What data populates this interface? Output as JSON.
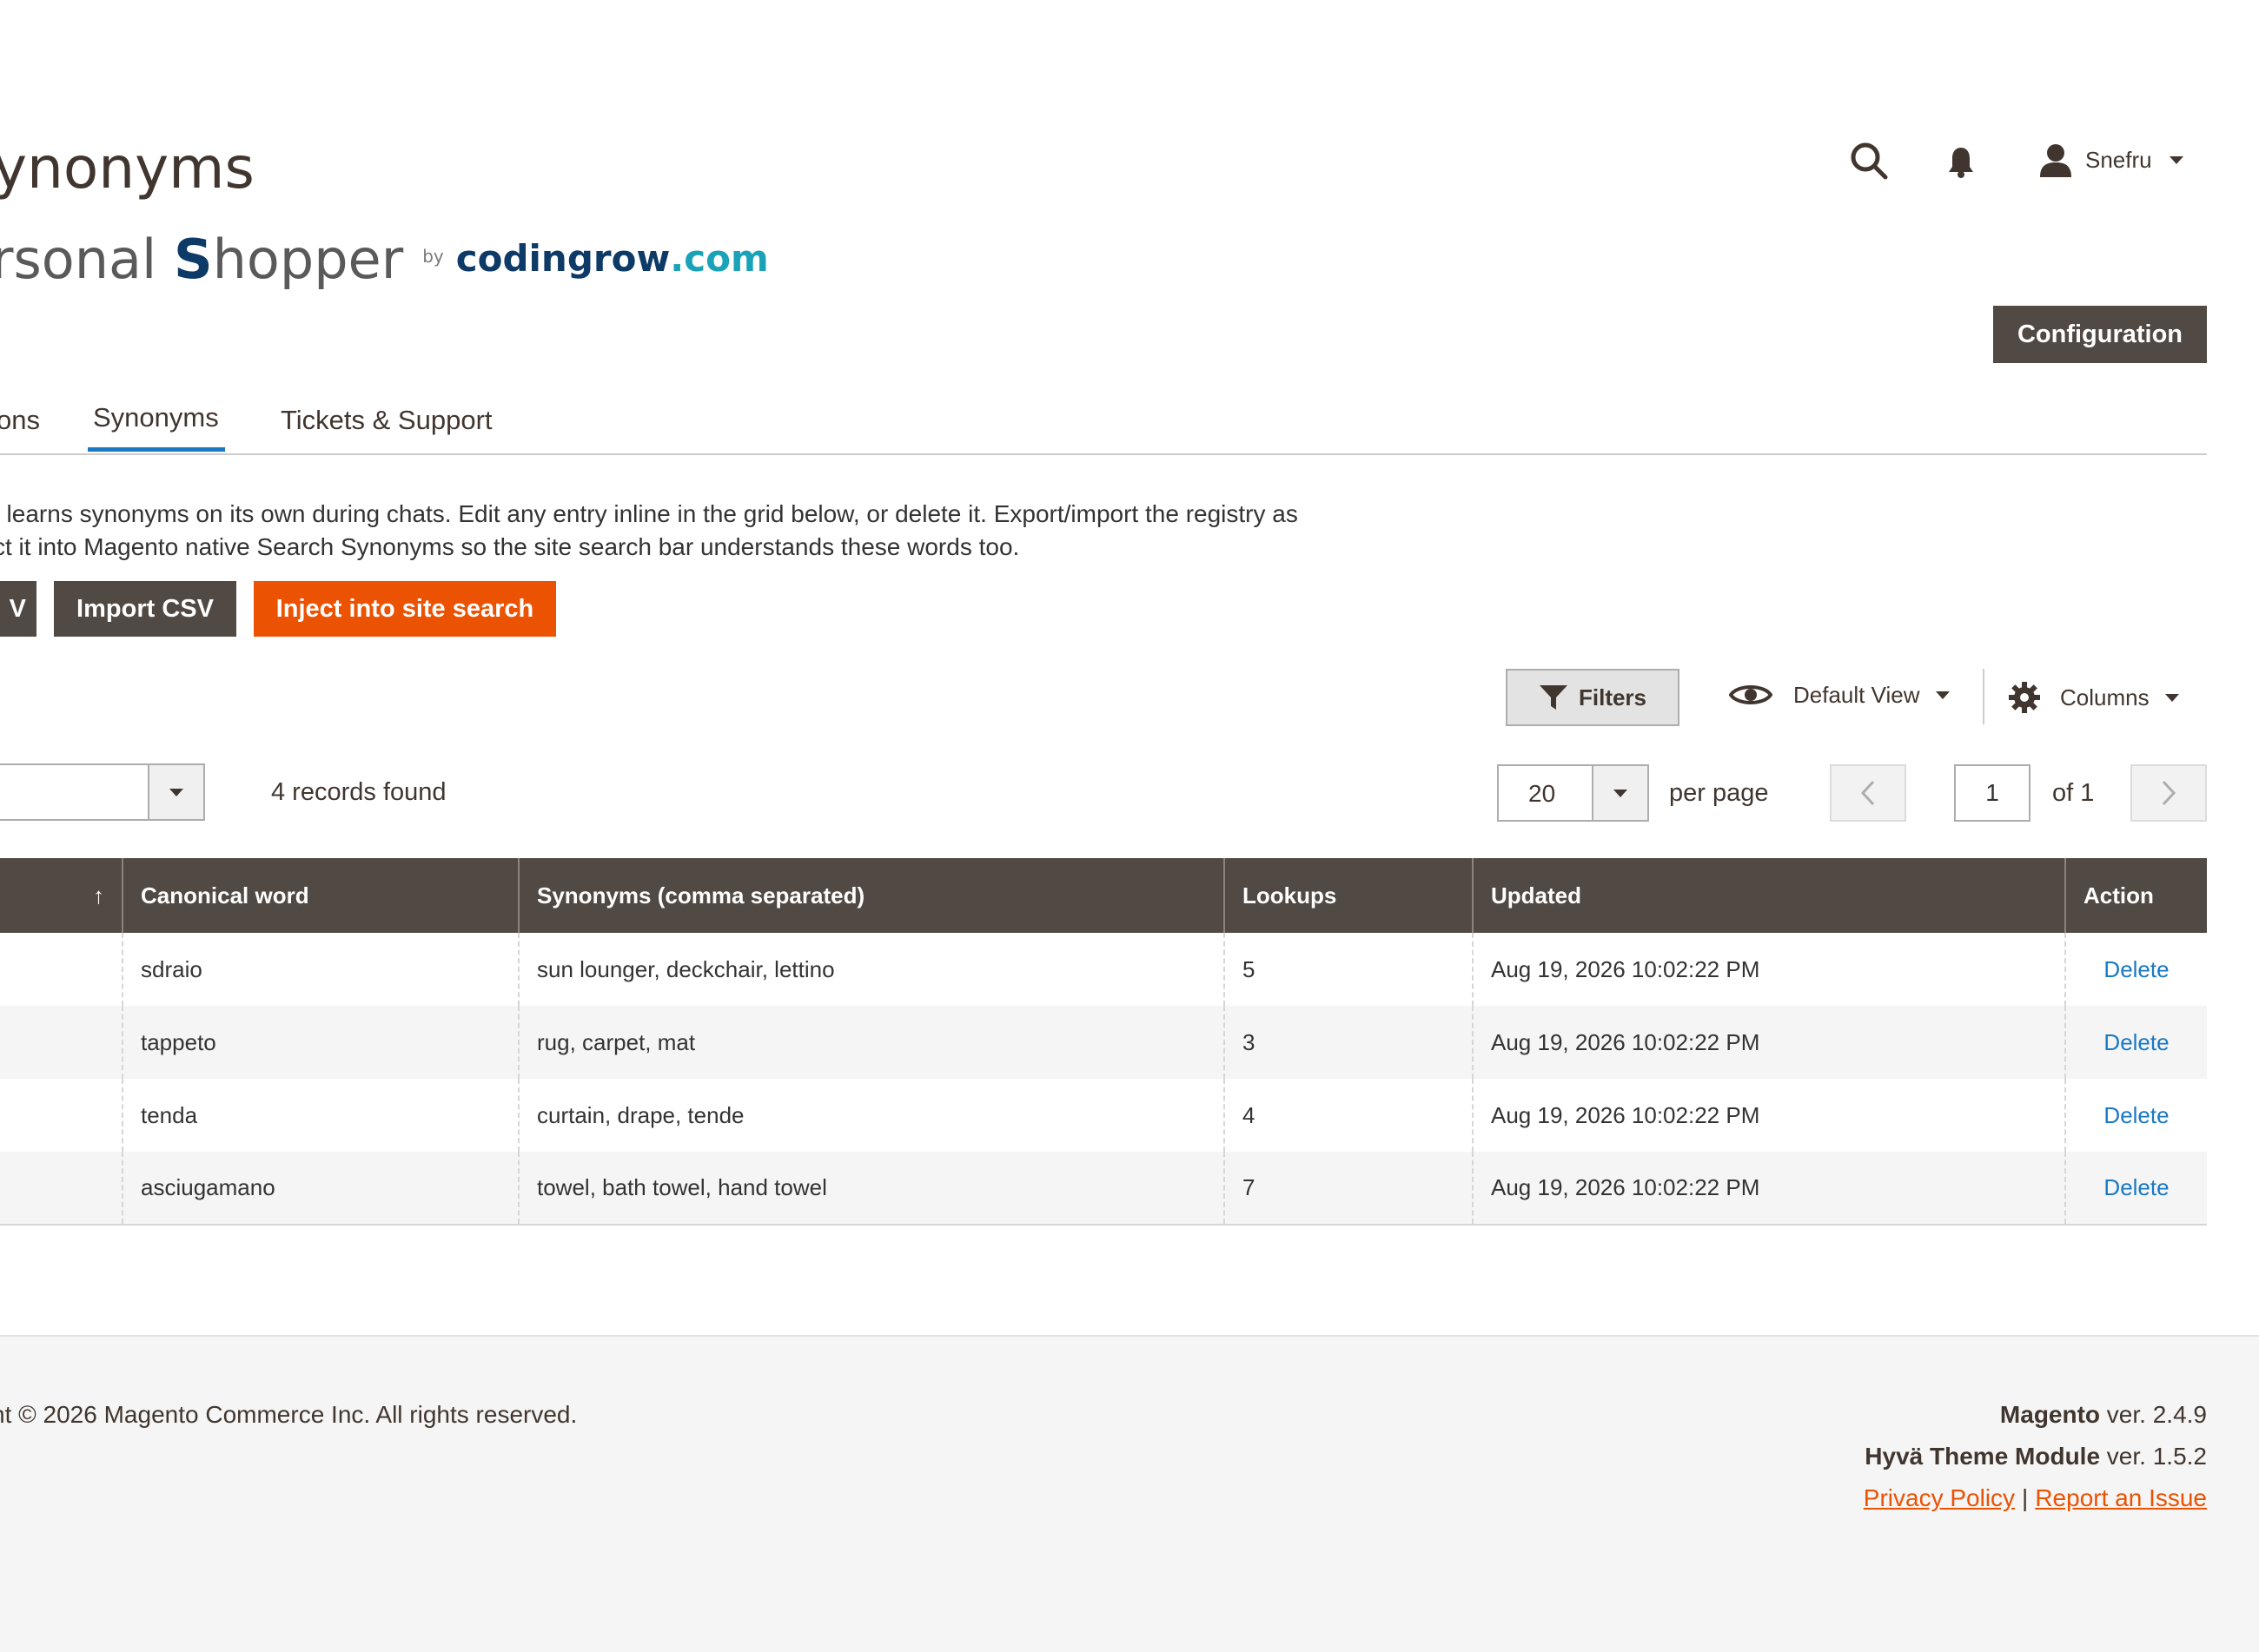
{
  "header": {
    "title": "ynonyms",
    "user_name": "Snefru",
    "icons": [
      "search-icon",
      "bell-icon",
      "user-icon",
      "chevron-down-icon"
    ]
  },
  "logo": {
    "text_start": "rsonal ",
    "text_s": "S",
    "text_end": "hopper",
    "by": "by",
    "brand_part1": "codingrow",
    "brand_part2": ".com"
  },
  "actions": {
    "configuration_label": "Configuration"
  },
  "tabs": [
    {
      "label": "ons",
      "active": false
    },
    {
      "label": "Synonyms",
      "active": true
    },
    {
      "label": "Tickets & Support",
      "active": false
    }
  ],
  "description": {
    "line1": "t learns synonyms on its own during chats. Edit any entry inline in the grid below, or delete it. Export/import the registry as",
    "line2": "ct it into Magento native Search Synonyms so the site search bar understands these words too."
  },
  "registry_buttons": {
    "export_label": "V",
    "import_label": "Import CSV",
    "inject_label": "Inject into site search"
  },
  "toolbar": {
    "filters_label": "Filters",
    "view_label": "Default View",
    "columns_label": "Columns",
    "records_found": "4 records found",
    "per_page_value": "20",
    "per_page_label": "per page",
    "current_page": "1",
    "of_pages": "of 1"
  },
  "grid": {
    "columns": [
      "Canonical word",
      "Synonyms (comma separated)",
      "Lookups",
      "Updated",
      "Action"
    ],
    "sort_indicator": "↑",
    "rows": [
      {
        "canonical": "sdraio",
        "synonyms": "sun lounger, deckchair, lettino",
        "lookups": "5",
        "updated": "Aug 19, 2026 10:02:22 PM",
        "action": "Delete"
      },
      {
        "canonical": "tappeto",
        "synonyms": "rug, carpet, mat",
        "lookups": "3",
        "updated": "Aug 19, 2026 10:02:22 PM",
        "action": "Delete"
      },
      {
        "canonical": "tenda",
        "synonyms": "curtain, drape, tende",
        "lookups": "4",
        "updated": "Aug 19, 2026 10:02:22 PM",
        "action": "Delete"
      },
      {
        "canonical": "asciugamano",
        "synonyms": "towel, bath towel, hand towel",
        "lookups": "7",
        "updated": "Aug 19, 2026 10:02:22 PM",
        "action": "Delete"
      }
    ]
  },
  "footer": {
    "copyright": "ht © 2026 Magento Commerce Inc. All rights reserved.",
    "magento_name": "Magento",
    "magento_version": " ver. 2.4.9",
    "hyva_name": "Hyvä Theme Module",
    "hyva_version": " ver. 1.5.2",
    "privacy_label": "Privacy Policy",
    "separator": "|",
    "report_label": "Report an Issue"
  },
  "colors": {
    "dark_button": "#514943",
    "accent_orange": "#eb5202",
    "link_blue": "#1979c3",
    "brand_navy": "#0d3a66",
    "brand_teal": "#1aa3b8"
  }
}
